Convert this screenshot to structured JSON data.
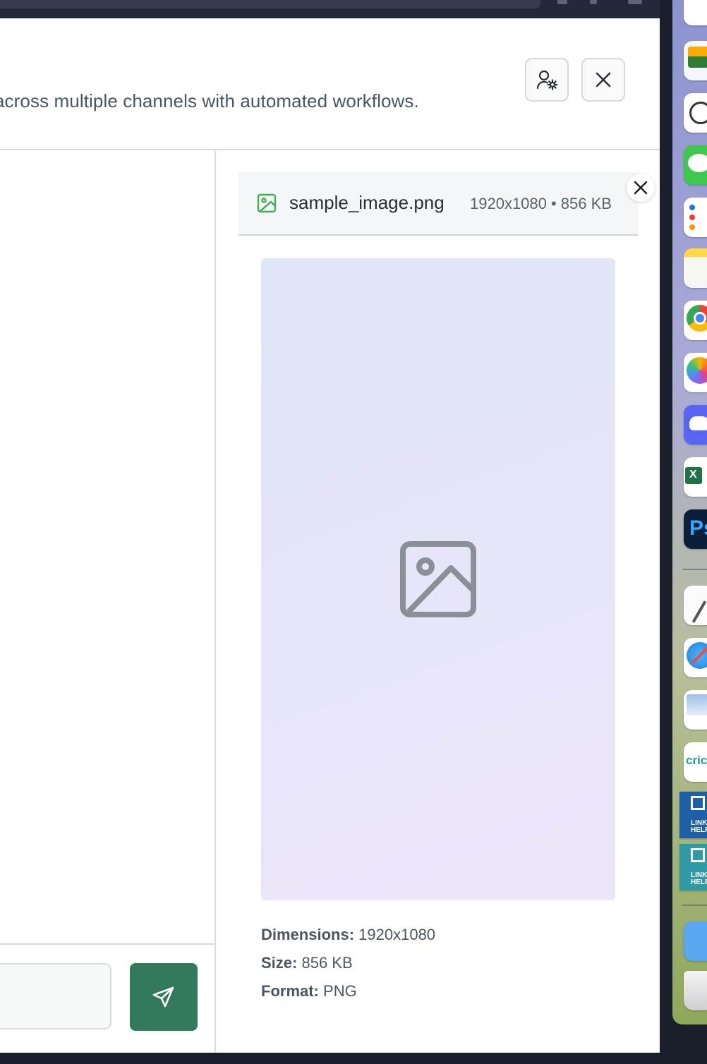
{
  "header": {
    "description": "across multiple channels with automated workflows.",
    "user_settings_icon": "user-cog-icon",
    "close_icon": "close-icon"
  },
  "preview": {
    "file_icon": "image-file-icon",
    "file_name": "sample_image.png",
    "file_meta": "1920x1080 • 856 KB",
    "placeholder_icon": "image-placeholder-icon",
    "info": {
      "dimensions_label": "Dimensions:",
      "dimensions_value": "1920x1080",
      "size_label": "Size:",
      "size_value": "856 KB",
      "format_label": "Format:",
      "format_value": "PNG"
    },
    "close_icon": "close-icon"
  },
  "composer": {
    "send_icon": "send-icon"
  },
  "dock": {
    "items": [
      {
        "name": "dock-app-slack"
      },
      {
        "name": "dock-app-google-chat"
      },
      {
        "name": "dock-app-chatgpt"
      },
      {
        "name": "dock-app-messages"
      },
      {
        "name": "dock-app-reminders"
      },
      {
        "name": "dock-app-notes"
      },
      {
        "name": "dock-app-chrome"
      },
      {
        "name": "dock-app-photos"
      },
      {
        "name": "dock-app-discord"
      },
      {
        "name": "dock-app-excel",
        "label": "X"
      },
      {
        "name": "dock-app-photoshop",
        "label": "Ps"
      },
      {
        "name": "dock-app-textedit"
      },
      {
        "name": "dock-app-safari"
      },
      {
        "name": "dock-app-preview"
      },
      {
        "name": "dock-app-cricut",
        "label": "cric"
      },
      {
        "name": "dock-app-link-helper-1",
        "label": "LINK HELP"
      },
      {
        "name": "dock-app-link-helper-2",
        "label": "LINK HELP"
      },
      {
        "name": "dock-folder"
      },
      {
        "name": "dock-trash"
      }
    ],
    "colors": {
      "messages": "#3ec94e",
      "discord": "#5865f2",
      "excel": "#1f7244",
      "photoshop": "#0b1e3a",
      "link_helper_1": "#1d5fa8",
      "link_helper_2": "#2e9aa6",
      "send_button": "#337a5c"
    }
  }
}
